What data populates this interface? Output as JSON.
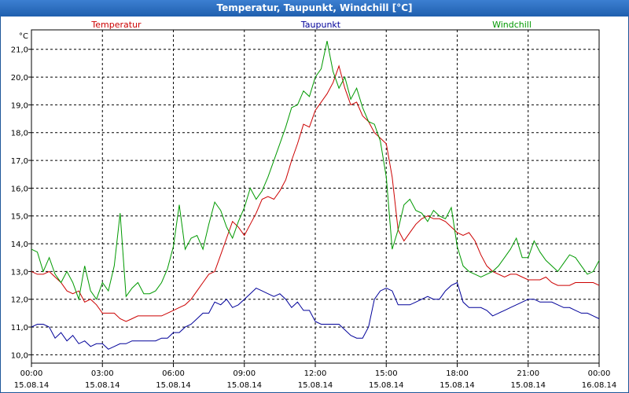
{
  "window": {
    "title": "Temperatur, Taupunkt, Windchill [°C]"
  },
  "chart_data": {
    "type": "line",
    "unit_label": "°C",
    "ylim": [
      9.7,
      21.7
    ],
    "yticks": [
      "10,0",
      "11,0",
      "12,0",
      "13,0",
      "14,0",
      "15,0",
      "16,0",
      "17,0",
      "18,0",
      "19,0",
      "20,0",
      "21,0"
    ],
    "xlim": [
      0,
      24
    ],
    "xticks": [
      {
        "time": "00:00",
        "date": "15.08.14"
      },
      {
        "time": "03:00",
        "date": "15.08.14"
      },
      {
        "time": "06:00",
        "date": "15.08.14"
      },
      {
        "time": "09:00",
        "date": "15.08.14"
      },
      {
        "time": "12:00",
        "date": "15.08.14"
      },
      {
        "time": "15:00",
        "date": "15.08.14"
      },
      {
        "time": "18:00",
        "date": "15.08.14"
      },
      {
        "time": "21:00",
        "date": "15.08.14"
      },
      {
        "time": "00:00",
        "date": "16.08.14"
      }
    ],
    "grid": true,
    "legend_position": "top",
    "series": [
      {
        "name": "Temperatur",
        "color": "#cc0000",
        "x": [
          0,
          0.25,
          0.5,
          0.75,
          1,
          1.25,
          1.5,
          1.75,
          2,
          2.25,
          2.5,
          2.75,
          3,
          3.25,
          3.5,
          3.75,
          4,
          4.25,
          4.5,
          4.75,
          5,
          5.25,
          5.5,
          5.75,
          6,
          6.25,
          6.5,
          6.75,
          7,
          7.25,
          7.5,
          7.75,
          8,
          8.25,
          8.5,
          8.75,
          9,
          9.25,
          9.5,
          9.75,
          10,
          10.25,
          10.5,
          10.75,
          11,
          11.25,
          11.5,
          11.75,
          12,
          12.25,
          12.5,
          12.75,
          13,
          13.25,
          13.5,
          13.75,
          14,
          14.25,
          14.5,
          14.75,
          15,
          15.25,
          15.5,
          15.75,
          16,
          16.25,
          16.5,
          16.75,
          17,
          17.25,
          17.5,
          17.75,
          18,
          18.25,
          18.5,
          18.75,
          19,
          19.25,
          19.5,
          19.75,
          20,
          20.25,
          20.5,
          20.75,
          21,
          21.25,
          21.5,
          21.75,
          22,
          22.25,
          22.5,
          22.75,
          23,
          23.25,
          23.5,
          23.75,
          24
        ],
        "y": [
          13.0,
          12.9,
          12.9,
          13.0,
          12.8,
          12.6,
          12.3,
          12.2,
          12.3,
          11.9,
          12.0,
          11.8,
          11.5,
          11.5,
          11.5,
          11.3,
          11.2,
          11.3,
          11.4,
          11.4,
          11.4,
          11.4,
          11.4,
          11.5,
          11.6,
          11.7,
          11.8,
          12.0,
          12.3,
          12.6,
          12.9,
          13.0,
          13.6,
          14.2,
          14.8,
          14.6,
          14.3,
          14.7,
          15.1,
          15.6,
          15.7,
          15.6,
          15.9,
          16.3,
          17.0,
          17.6,
          18.3,
          18.2,
          18.8,
          19.1,
          19.4,
          19.8,
          20.4,
          19.6,
          19.0,
          19.1,
          18.6,
          18.4,
          18.0,
          17.8,
          17.6,
          16.4,
          14.5,
          14.1,
          14.4,
          14.7,
          14.9,
          15.0,
          14.9,
          14.9,
          14.8,
          14.6,
          14.4,
          14.3,
          14.4,
          14.1,
          13.6,
          13.2,
          13.0,
          12.9,
          12.8,
          12.9,
          12.9,
          12.8,
          12.7,
          12.7,
          12.7,
          12.8,
          12.6,
          12.5,
          12.5,
          12.5,
          12.6,
          12.6,
          12.6,
          12.6,
          12.5
        ],
        "values": [
          13.0,
          12.9,
          12.9,
          13.0,
          12.8,
          12.6,
          12.3,
          12.2,
          12.3,
          11.9,
          12.0,
          11.8,
          11.5,
          11.5,
          11.5,
          11.3,
          11.2,
          11.3,
          11.4,
          11.4,
          11.4,
          11.4,
          11.4,
          11.5,
          11.6,
          11.7,
          11.8,
          12.0,
          12.3,
          12.6,
          12.9,
          13.0,
          13.6,
          14.2,
          14.8,
          14.6,
          14.3,
          14.7,
          15.1,
          15.6,
          15.7,
          15.6,
          15.9,
          16.3,
          17.0,
          17.6,
          18.3,
          18.2,
          18.8,
          19.1,
          19.4,
          19.8,
          20.4,
          19.6,
          19.0,
          19.1,
          18.6,
          18.4,
          18.0,
          17.8,
          17.6,
          16.4,
          14.5,
          14.1,
          14.4,
          14.7,
          14.9,
          15.0,
          14.9,
          14.9,
          14.8,
          14.6,
          14.4,
          14.3,
          14.4,
          14.1,
          13.6,
          13.2,
          13.0,
          12.9,
          12.8,
          12.9,
          12.9,
          12.8,
          12.7,
          12.7,
          12.7,
          12.8,
          12.6,
          12.5,
          12.5,
          12.5,
          12.6,
          12.6,
          12.6,
          12.6,
          12.5
        ]
      },
      {
        "name": "Taupunkt",
        "color": "#000099",
        "x": [
          0,
          0.25,
          0.5,
          0.75,
          1,
          1.25,
          1.5,
          1.75,
          2,
          2.25,
          2.5,
          2.75,
          3,
          3.25,
          3.5,
          3.75,
          4,
          4.25,
          4.5,
          4.75,
          5,
          5.25,
          5.5,
          5.75,
          6,
          6.25,
          6.5,
          6.75,
          7,
          7.25,
          7.5,
          7.75,
          8,
          8.25,
          8.5,
          8.75,
          9,
          9.25,
          9.5,
          9.75,
          10,
          10.25,
          10.5,
          10.75,
          11,
          11.25,
          11.5,
          11.75,
          12,
          12.25,
          12.5,
          12.75,
          13,
          13.25,
          13.5,
          13.75,
          14,
          14.25,
          14.5,
          14.75,
          15,
          15.25,
          15.5,
          15.75,
          16,
          16.25,
          16.5,
          16.75,
          17,
          17.25,
          17.5,
          17.75,
          18,
          18.25,
          18.5,
          18.75,
          19,
          19.25,
          19.5,
          19.75,
          20,
          20.25,
          20.5,
          20.75,
          21,
          21.25,
          21.5,
          21.75,
          22,
          22.25,
          22.5,
          22.75,
          23,
          23.25,
          23.5,
          23.75,
          24
        ],
        "y": [
          11.0,
          11.1,
          11.1,
          11.0,
          10.6,
          10.8,
          10.5,
          10.7,
          10.4,
          10.5,
          10.3,
          10.4,
          10.4,
          10.2,
          10.3,
          10.4,
          10.4,
          10.5,
          10.5,
          10.5,
          10.5,
          10.5,
          10.6,
          10.6,
          10.8,
          10.8,
          11.0,
          11.1,
          11.3,
          11.5,
          11.5,
          11.9,
          11.8,
          12.0,
          11.7,
          11.8,
          12.0,
          12.2,
          12.4,
          12.3,
          12.2,
          12.1,
          12.2,
          12.0,
          11.7,
          11.9,
          11.6,
          11.6,
          11.2,
          11.1,
          11.1,
          11.1,
          11.1,
          10.9,
          10.7,
          10.6,
          10.6,
          11.0,
          12.0,
          12.3,
          12.4,
          12.3,
          11.8,
          11.8,
          11.8,
          11.9,
          12.0,
          12.1,
          12.0,
          12.0,
          12.3,
          12.5,
          12.6,
          11.9,
          11.7,
          11.7,
          11.7,
          11.6,
          11.4,
          11.5,
          11.6,
          11.7,
          11.8,
          11.9,
          12.0,
          12.0,
          11.9,
          11.9,
          11.9,
          11.8,
          11.7,
          11.7,
          11.6,
          11.5,
          11.5,
          11.4,
          11.3
        ],
        "values": [
          11.0,
          11.1,
          11.1,
          11.0,
          10.6,
          10.8,
          10.5,
          10.7,
          10.4,
          10.5,
          10.3,
          10.4,
          10.4,
          10.2,
          10.3,
          10.4,
          10.4,
          10.5,
          10.5,
          10.5,
          10.5,
          10.5,
          10.6,
          10.6,
          10.8,
          10.8,
          11.0,
          11.1,
          11.3,
          11.5,
          11.5,
          11.9,
          11.8,
          12.0,
          11.7,
          11.8,
          12.0,
          12.2,
          12.4,
          12.3,
          12.2,
          12.1,
          12.2,
          12.0,
          11.7,
          11.9,
          11.6,
          11.6,
          11.2,
          11.1,
          11.1,
          11.1,
          11.1,
          10.9,
          10.7,
          10.6,
          10.6,
          11.0,
          12.0,
          12.3,
          12.4,
          12.3,
          11.8,
          11.8,
          11.8,
          11.9,
          12.0,
          12.1,
          12.0,
          12.0,
          12.3,
          12.5,
          12.6,
          11.9,
          11.7,
          11.7,
          11.7,
          11.6,
          11.4,
          11.5,
          11.6,
          11.7,
          11.8,
          11.9,
          12.0,
          12.0,
          11.9,
          11.9,
          11.9,
          11.8,
          11.7,
          11.7,
          11.6,
          11.5,
          11.5,
          11.4,
          11.3
        ]
      },
      {
        "name": "Windchill",
        "color": "#009900",
        "x": [
          0,
          0.25,
          0.5,
          0.75,
          1,
          1.25,
          1.5,
          1.75,
          2,
          2.25,
          2.5,
          2.75,
          3,
          3.25,
          3.5,
          3.75,
          4,
          4.25,
          4.5,
          4.75,
          5,
          5.25,
          5.5,
          5.75,
          6,
          6.25,
          6.5,
          6.75,
          7,
          7.25,
          7.5,
          7.75,
          8,
          8.25,
          8.5,
          8.75,
          9,
          9.25,
          9.5,
          9.75,
          10,
          10.25,
          10.5,
          10.75,
          11,
          11.25,
          11.5,
          11.75,
          12,
          12.25,
          12.5,
          12.75,
          13,
          13.25,
          13.5,
          13.75,
          14,
          14.25,
          14.5,
          14.75,
          15,
          15.25,
          15.5,
          15.75,
          16,
          16.25,
          16.5,
          16.75,
          17,
          17.25,
          17.5,
          17.75,
          18,
          18.25,
          18.5,
          18.75,
          19,
          19.25,
          19.5,
          19.75,
          20,
          20.25,
          20.5,
          20.75,
          21,
          21.25,
          21.5,
          21.75,
          22,
          22.25,
          22.5,
          22.75,
          23,
          23.25,
          23.5,
          23.75,
          24
        ],
        "y": [
          13.8,
          13.7,
          13.0,
          13.5,
          12.9,
          12.6,
          13.0,
          12.6,
          12.0,
          13.2,
          12.3,
          12.0,
          12.6,
          12.3,
          13.2,
          15.1,
          12.1,
          12.4,
          12.6,
          12.2,
          12.2,
          12.3,
          12.6,
          13.1,
          13.9,
          15.4,
          13.8,
          14.2,
          14.3,
          13.8,
          14.7,
          15.5,
          15.2,
          14.6,
          14.2,
          14.8,
          15.3,
          16.0,
          15.6,
          15.9,
          16.4,
          17.0,
          17.6,
          18.2,
          18.9,
          19.0,
          19.5,
          19.3,
          20.0,
          20.3,
          21.3,
          20.2,
          19.6,
          20.0,
          19.2,
          19.6,
          18.9,
          18.4,
          18.3,
          17.7,
          16.4,
          13.8,
          14.5,
          15.4,
          15.6,
          15.2,
          15.1,
          14.8,
          15.2,
          15.0,
          14.9,
          15.3,
          13.9,
          13.2,
          13.0,
          12.9,
          12.8,
          12.9,
          13.0,
          13.2,
          13.5,
          13.8,
          14.2,
          13.5,
          13.5,
          14.1,
          13.7,
          13.4,
          13.2,
          13.0,
          13.3,
          13.6,
          13.5,
          13.2,
          12.9,
          13.0,
          13.4
        ],
        "values": [
          13.8,
          13.7,
          13.0,
          13.5,
          12.9,
          12.6,
          13.0,
          12.6,
          12.0,
          13.2,
          12.3,
          12.0,
          12.6,
          12.3,
          13.2,
          15.1,
          12.1,
          12.4,
          12.6,
          12.2,
          12.2,
          12.3,
          12.6,
          13.1,
          13.9,
          15.4,
          13.8,
          14.2,
          14.3,
          13.8,
          14.7,
          15.5,
          15.2,
          14.6,
          14.2,
          14.8,
          15.3,
          16.0,
          15.6,
          15.9,
          16.4,
          17.0,
          17.6,
          18.2,
          18.9,
          19.0,
          19.5,
          19.3,
          20.0,
          20.3,
          21.3,
          20.2,
          19.6,
          20.0,
          19.2,
          19.6,
          18.9,
          18.4,
          18.3,
          17.7,
          16.4,
          13.8,
          14.5,
          15.4,
          15.6,
          15.2,
          15.1,
          14.8,
          15.2,
          15.0,
          14.9,
          15.3,
          13.9,
          13.2,
          13.0,
          12.9,
          12.8,
          12.9,
          13.0,
          13.2,
          13.5,
          13.8,
          14.2,
          13.5,
          13.5,
          14.1,
          13.7,
          13.4,
          13.2,
          13.0,
          13.3,
          13.6,
          13.5,
          13.2,
          12.9,
          13.0,
          13.4
        ]
      }
    ]
  }
}
